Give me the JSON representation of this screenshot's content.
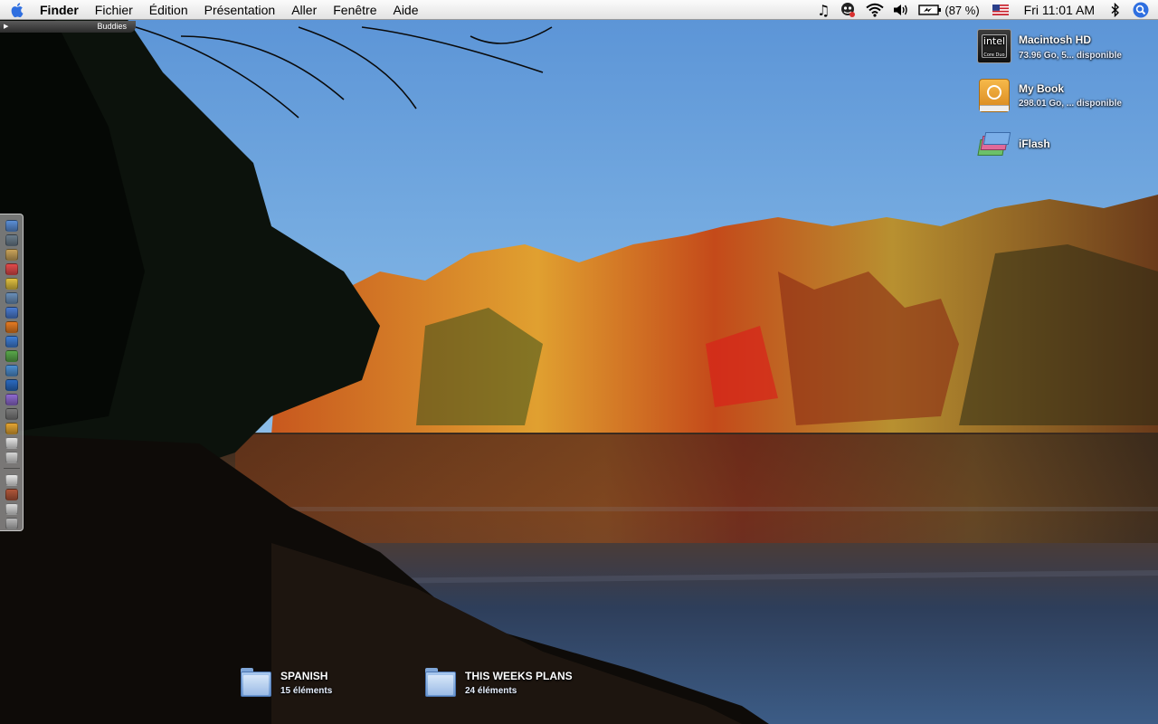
{
  "menubar": {
    "apple_icon": "apple-icon",
    "app_name": "Finder",
    "items": [
      "Fichier",
      "Édition",
      "Présentation",
      "Aller",
      "Fenêtre",
      "Aide"
    ],
    "status": {
      "music_icon": "music-note-icon",
      "user_icon": "user-status-icon",
      "wifi_icon": "wifi-icon",
      "volume_icon": "volume-icon",
      "battery_icon": "battery-icon",
      "battery_percent": "(87 %)",
      "input_flag_icon": "us-flag-icon",
      "clock": "Fri 11:01 AM",
      "bluetooth_icon": "bluetooth-icon",
      "spotlight_icon": "spotlight-icon"
    }
  },
  "buddies": {
    "label": "Buddies"
  },
  "dock": {
    "icons": [
      {
        "name": "finder",
        "color": "#5b8fd6"
      },
      {
        "name": "network",
        "color": "#6b7d8c"
      },
      {
        "name": "book",
        "color": "#c9a35a"
      },
      {
        "name": "calendar",
        "color": "#e34b4b"
      },
      {
        "name": "tools",
        "color": "#e0c040"
      },
      {
        "name": "photo",
        "color": "#6a8fb8"
      },
      {
        "name": "safari",
        "color": "#4a7bd0"
      },
      {
        "name": "firefox",
        "color": "#e57b22"
      },
      {
        "name": "sync",
        "color": "#3f7ed6"
      },
      {
        "name": "ichat",
        "color": "#59a84a"
      },
      {
        "name": "itunes",
        "color": "#4d8fd0"
      },
      {
        "name": "quicktime",
        "color": "#2a6ac0"
      },
      {
        "name": "system",
        "color": "#8f6ad0"
      },
      {
        "name": "utility",
        "color": "#7a7a7a"
      },
      {
        "name": "money",
        "color": "#e4a532"
      },
      {
        "name": "preview",
        "color": "#e6e6e6"
      },
      {
        "name": "mail",
        "color": "#d6d6d6"
      }
    ],
    "icons_lower": [
      {
        "name": "document",
        "color": "#e8e8e8"
      },
      {
        "name": "folder",
        "color": "#b0563a"
      },
      {
        "name": "printer",
        "color": "#dcdcdc"
      },
      {
        "name": "trash",
        "color": "#b8b8b8"
      }
    ]
  },
  "desktop": {
    "volumes": [
      {
        "name": "Macintosh HD",
        "info": "73.96 Go, 5... disponible",
        "icon": "hard-drive-icon"
      },
      {
        "name": "My Book",
        "info": "298.01 Go, ... disponible",
        "icon": "external-drive-icon"
      },
      {
        "name": "iFlash",
        "info": "",
        "icon": "flash-drive-icon"
      }
    ],
    "folders": [
      {
        "name": "SPANISH",
        "info": "15 éléments",
        "icon": "folder-icon"
      },
      {
        "name": "THIS WEEKS PLANS",
        "info": "24 éléments",
        "icon": "folder-icon"
      }
    ]
  }
}
